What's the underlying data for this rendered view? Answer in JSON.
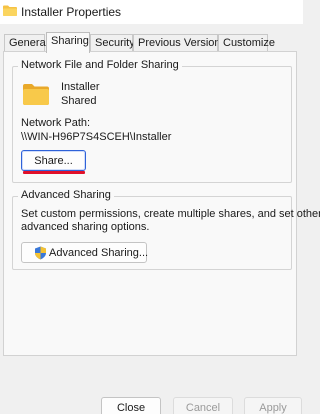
{
  "window": {
    "title": "Installer Properties"
  },
  "tabs": [
    {
      "label": "General"
    },
    {
      "label": "Sharing"
    },
    {
      "label": "Security"
    },
    {
      "label": "Previous Versions"
    },
    {
      "label": "Customize"
    }
  ],
  "network_sharing": {
    "legend": "Network File and Folder Sharing",
    "folder_name": "Installer",
    "status": "Shared",
    "path_label": "Network Path:",
    "path_value": "\\\\WIN-H96P7S4SCEH\\Installer",
    "share_button": "Share..."
  },
  "advanced_sharing": {
    "legend": "Advanced Sharing",
    "description_line1": "Set custom permissions, create multiple shares, and set other",
    "description_line2": "advanced sharing options.",
    "button": "Advanced Sharing..."
  },
  "footer": {
    "close": "Close",
    "cancel": "Cancel",
    "apply": "Apply"
  },
  "colors": {
    "annotation_underline": "#e0102a",
    "folder": "#f6c244"
  },
  "icons": {
    "title": "folder-icon",
    "share_folder": "folder-icon",
    "advanced_button": "uac-shield-icon"
  }
}
